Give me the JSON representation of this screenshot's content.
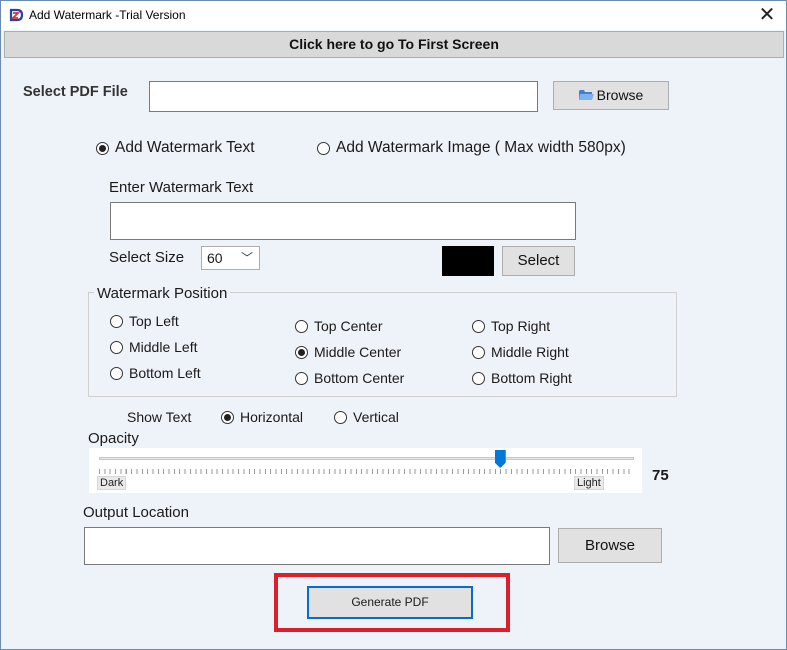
{
  "window": {
    "title": "Add Watermark  -Trial Version",
    "close_glyph": "✕"
  },
  "top_bar": {
    "label": "Click here to go To First Screen"
  },
  "select_pdf": {
    "label": "Select PDF File",
    "value": "",
    "browse_label": "Browse",
    "browse_icon": "folder-icon"
  },
  "mode": {
    "text_option": "Add Watermark Text",
    "image_option": "Add Watermark Image ( Max width 580px)",
    "selected": "text"
  },
  "watermark_text": {
    "label": "Enter Watermark Text",
    "value": ""
  },
  "size": {
    "label": "Select Size",
    "value": "60"
  },
  "color": {
    "swatch": "#000000",
    "select_label": "Select"
  },
  "position": {
    "title": "Watermark Position",
    "options": [
      "Top Left",
      "Middle Left",
      "Bottom Left",
      "Top Center",
      "Middle Center",
      "Bottom Center",
      "Top Right",
      "Middle Right",
      "Bottom Right"
    ],
    "selected": "Middle Center"
  },
  "orientation": {
    "label": "Show Text",
    "horizontal": "Horizontal",
    "vertical": "Vertical",
    "selected": "horizontal"
  },
  "opacity": {
    "label": "Opacity",
    "value": "75",
    "fraction": 0.75,
    "dark_label": "Dark",
    "light_label": "Light"
  },
  "output": {
    "label": "Output Location",
    "value": "",
    "browse_label": "Browse"
  },
  "generate": {
    "label": "Generate PDF"
  },
  "colors": {
    "accent": "#0078d7",
    "highlight": "#dd1f2b"
  }
}
